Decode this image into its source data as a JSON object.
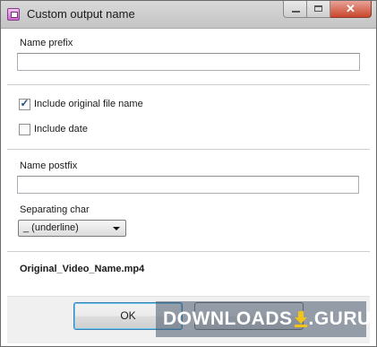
{
  "window": {
    "title": "Custom output name",
    "controls": {
      "minimize_icon": "minimize-icon",
      "maximize_icon": "maximize-icon",
      "close_icon": "close-icon",
      "close_glyph": "✕"
    }
  },
  "form": {
    "prefix_label": "Name prefix",
    "prefix_value": "",
    "include_original_label": "Include original file name",
    "include_original_checked": true,
    "include_date_label": "Include date",
    "include_date_checked": false,
    "postfix_label": "Name postfix",
    "postfix_value": "",
    "separating_char_label": "Separating char",
    "separating_char_value": "_ (underline)"
  },
  "preview": {
    "filename": "Original_Video_Name.mp4"
  },
  "buttons": {
    "ok_label": "OK"
  },
  "watermark": {
    "text_left": "DOWNLOADS",
    "text_right": ".GURU",
    "icon": "download-arrow-icon",
    "accent_color": "#f2c318"
  },
  "colors": {
    "titlebar": "#cfcfcf",
    "close_button": "#c9462c",
    "checkmark": "#2b4e74",
    "default_button_border": "#3c7fb1"
  }
}
